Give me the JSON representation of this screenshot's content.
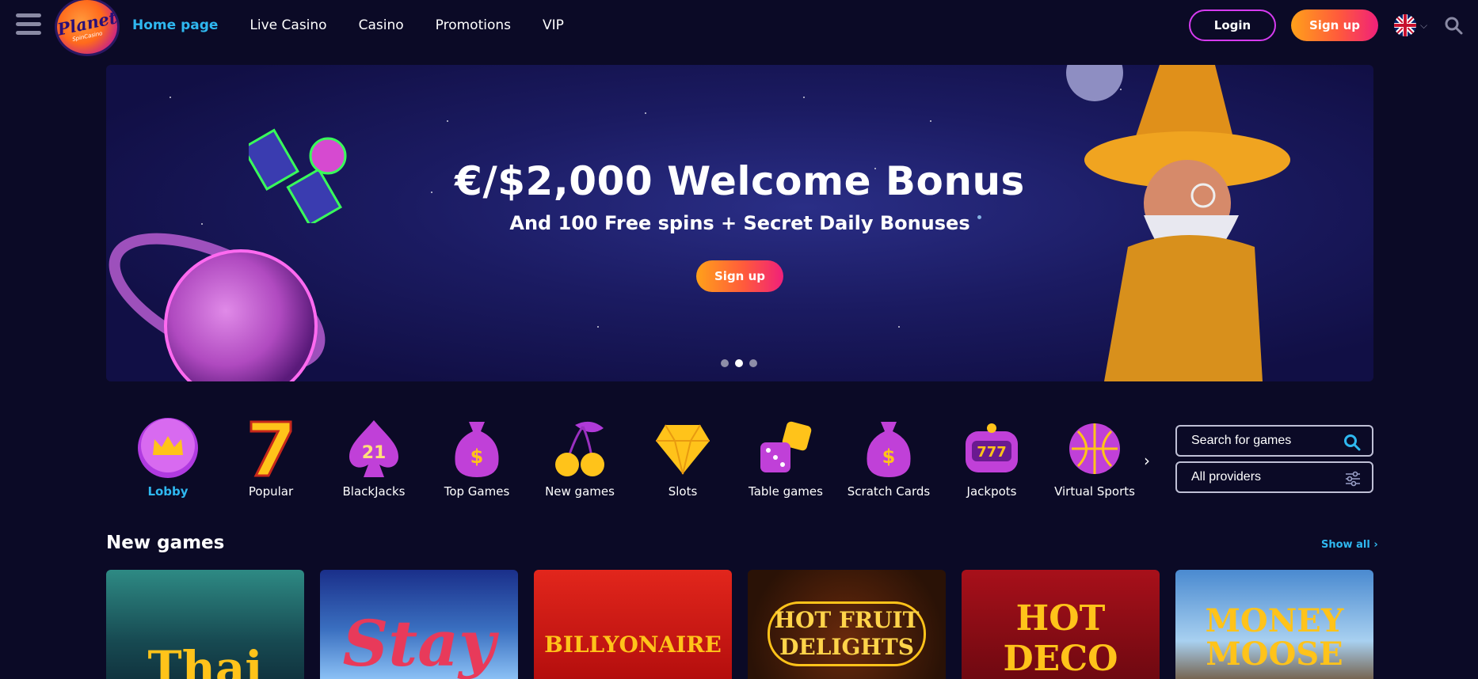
{
  "header": {
    "logo_main": "Planet",
    "logo_sub": "SpinCasino",
    "nav": [
      "Home page",
      "Live Casino",
      "Casino",
      "Promotions",
      "VIP"
    ],
    "login_label": "Login",
    "signup_label": "Sign up",
    "language_flag": "uk-flag-icon"
  },
  "banner": {
    "title": "€/$2,000 Welcome Bonus",
    "subtitle": "And 100 Free spins + Secret Daily Bonuses",
    "cta_label": "Sign up",
    "slide_count": 3,
    "active_slide": 2
  },
  "categories": [
    {
      "label": "Lobby",
      "icon": "crown-icon",
      "active": true
    },
    {
      "label": "Popular",
      "icon": "seven-icon"
    },
    {
      "label": "BlackJacks",
      "icon": "spade-21-icon"
    },
    {
      "label": "Top Games",
      "icon": "money-bag-icon"
    },
    {
      "label": "New games",
      "icon": "cherries-icon"
    },
    {
      "label": "Slots",
      "icon": "diamond-icon"
    },
    {
      "label": "Table games",
      "icon": "dice-icon"
    },
    {
      "label": "Scratch Cards",
      "icon": "money-bag-icon"
    },
    {
      "label": "Jackpots",
      "icon": "slot-777-icon"
    },
    {
      "label": "Virtual Sports",
      "icon": "ball-icon"
    }
  ],
  "search": {
    "placeholder": "Search for games"
  },
  "providers": {
    "value": "All providers"
  },
  "new_games": {
    "title": "New games",
    "show_all": "Show all",
    "games": [
      {
        "name": "Thai",
        "theme": "#1f5a5a"
      },
      {
        "name": "Stay",
        "theme": "#3a6fc0"
      },
      {
        "name": "BILLYONAIRE",
        "theme": "#c6160f"
      },
      {
        "name": "HOT FRUIT DELIGHTS",
        "theme": "#3a1a08"
      },
      {
        "name": "HOT DECO",
        "theme": "#8a0c10"
      },
      {
        "name": "MONEY MOOSE",
        "theme": "#5e98d8"
      }
    ]
  },
  "colors": {
    "accent": "#2fb8f0",
    "background": "#0b0a26",
    "cta": "#ff7a2a",
    "login_border": "#d63bf0"
  }
}
